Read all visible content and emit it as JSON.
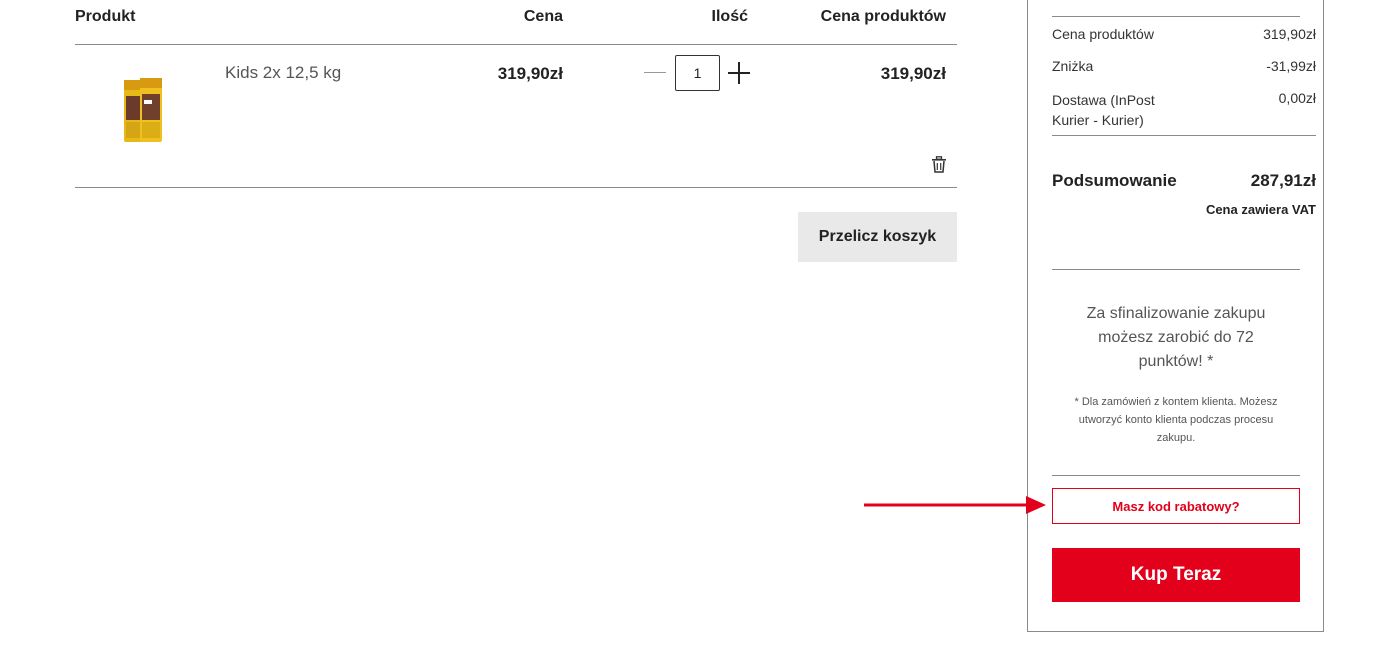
{
  "table": {
    "headers": {
      "product": "Produkt",
      "price": "Cena",
      "quantity": "Ilość",
      "total": "Cena produktów"
    },
    "rows": [
      {
        "image_icon": "dog-food-bag-icon",
        "name": "Kids 2x 12,5 kg",
        "price": "319,90zł",
        "quantity": "1",
        "total": "319,90zł"
      }
    ]
  },
  "actions": {
    "recalculate_label": "Przelicz koszyk"
  },
  "summary": {
    "rows": [
      {
        "label": "Cena produktów",
        "value": "319,90zł"
      },
      {
        "label": "Zniżka",
        "value": "-31,99zł"
      },
      {
        "label_line1": "Dostawa (InPost",
        "label_line2": "Kurier - Kurier)",
        "value": "0,00zł"
      }
    ],
    "total_label": "Podsumowanie",
    "total_value": "287,91zł",
    "vat_note": "Cena zawiera VAT",
    "points_line1": "Za sfinalizowanie zakupu",
    "points_line2": "możesz zarobić do 72",
    "points_line3": "punktów! *",
    "note_line1": "* Dla zamówień z kontem klienta. Możesz",
    "note_line2": "utworzyć konto klienta podczas procesu",
    "note_line3": "zakupu.",
    "coupon_label": "Masz kod rabatowy?",
    "buy_label": "Kup Teraz"
  },
  "colors": {
    "accent": "#e2001a",
    "button_grey": "#e9e9e9",
    "divider": "#8a8a8a"
  },
  "icons": [
    "trash-icon",
    "plus-icon",
    "minus-icon",
    "red-arrow-icon"
  ]
}
